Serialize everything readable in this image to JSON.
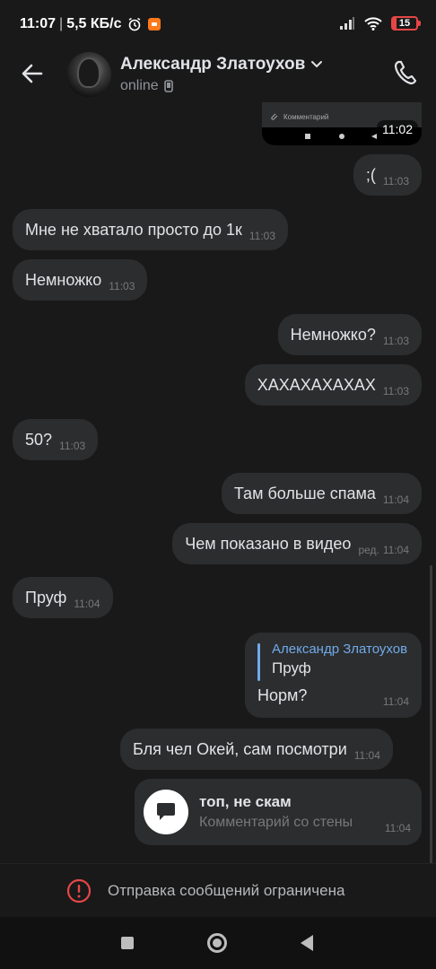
{
  "statusbar": {
    "time": "11:07",
    "speed": "5,5 КБ/с",
    "battery": "15",
    "separator": "|"
  },
  "header": {
    "name": "Александр Златоухов",
    "status": "online"
  },
  "media_preview": {
    "input_placeholder": "Комментарий",
    "time": "11:02"
  },
  "messages": [
    {
      "side": "out",
      "text": ";(",
      "time": "11:03"
    },
    {
      "side": "in",
      "text": "Мне не хватало просто до 1к",
      "time": "11:03"
    },
    {
      "side": "in",
      "text": "Немножко",
      "time": "11:03"
    },
    {
      "side": "out",
      "text": "Немножко?",
      "time": "11:03"
    },
    {
      "side": "out",
      "text": "ХАХАХАХАХАХ",
      "time": "11:03"
    },
    {
      "side": "in",
      "text": "50?",
      "time": "11:03"
    },
    {
      "side": "out",
      "text": "Там больше спама",
      "time": "11:04"
    },
    {
      "side": "out",
      "text": "Чем показано в видео",
      "edited": "ред.",
      "time": "11:04"
    },
    {
      "side": "in",
      "text": "Пруф",
      "time": "11:04"
    },
    {
      "side": "in",
      "text": "Бля чел Окей, сам посмотри",
      "time": "11:04"
    }
  ],
  "reply_message": {
    "quoted_author": "Александр Златоухов",
    "quoted_text": "Пруф",
    "text": "Норм?",
    "time": "11:04"
  },
  "wall_comment": {
    "title": "топ, не скам",
    "subtitle": "Комментарий со стены",
    "time": "11:04"
  },
  "restriction": {
    "text": "Отправка сообщений ограничена",
    "color": "#e64646"
  },
  "colors": {
    "background": "#19191a",
    "bubble": "#2c2d2e",
    "accent": "#71aaeb"
  }
}
